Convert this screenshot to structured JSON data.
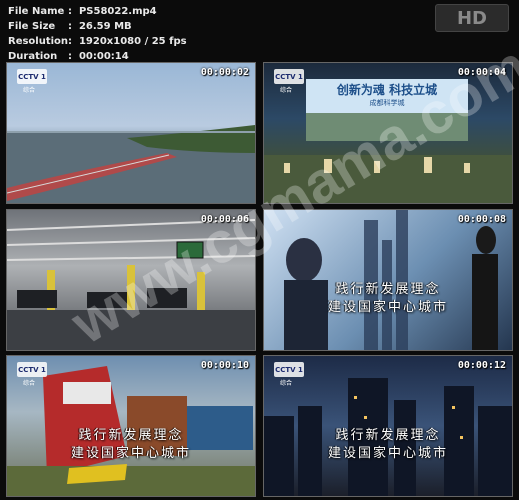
{
  "file_info": {
    "name_key": "File Name",
    "name_val": "PS58022.mp4",
    "size_key": "File Size",
    "size_val": "26.59 MB",
    "res_key": "Resolution",
    "res_val": "1920x1080 / 25 fps",
    "dur_key": "Duration",
    "dur_val": "00:00:14"
  },
  "badge": "HD",
  "watermark": "www.cgmama.com",
  "thumbnails": [
    {
      "time": "00:00:02",
      "logo": "CCTV 1",
      "logo_sub": "综合"
    },
    {
      "time": "00:00:04",
      "logo": "CCTV 1",
      "logo_sub": "综合",
      "banner": "创新为魂 科技立城",
      "banner_sub": "成都科学城"
    },
    {
      "time": "00:00:06"
    },
    {
      "time": "00:00:08",
      "caption_1": "践行新发展理念",
      "caption_2": "建设国家中心城市"
    },
    {
      "time": "00:00:10",
      "logo": "CCTV 1",
      "logo_sub": "综合",
      "caption_1": "践行新发展理念",
      "caption_2": "建设国家中心城市"
    },
    {
      "time": "00:00:12",
      "logo": "CCTV 1",
      "logo_sub": "综合",
      "caption_1": "践行新发展理念",
      "caption_2": "建设国家中心城市"
    }
  ]
}
